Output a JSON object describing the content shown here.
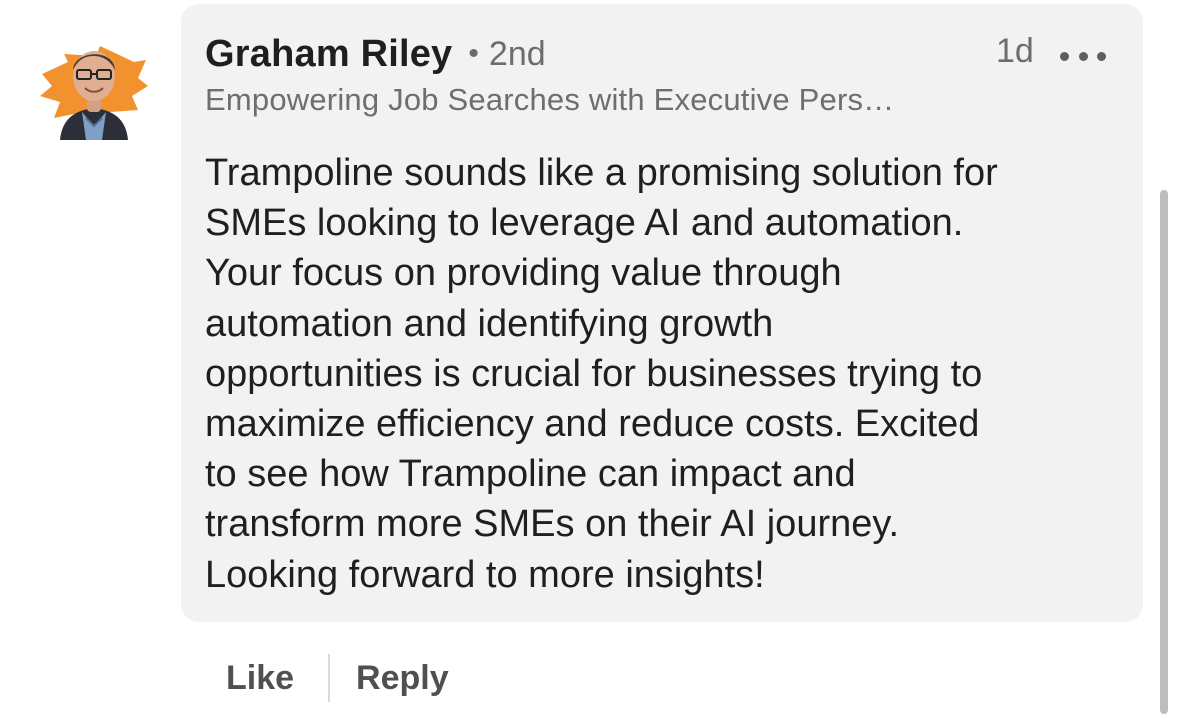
{
  "comment": {
    "author": {
      "name": "Graham Riley",
      "degree": "2nd",
      "headline": "Empowering Job Searches with Executive Pers…",
      "avatar_icon": "profile-photo",
      "avatar_accent": "#f2922f"
    },
    "separator": "•",
    "time": "1d",
    "more_icon": "more-options-icon",
    "text": "Trampoline sounds like a promising solution for\nSMEs looking to leverage AI and automation.\nYour focus on providing value through\nautomation and identifying growth\nopportunities is crucial for businesses trying to\nmaximize efficiency and reduce costs. Excited\nto see how Trampoline can impact and\ntransform more SMEs on their AI journey.\nLooking forward to more insights!",
    "bubble_color": "#f2f2f2"
  },
  "actions": {
    "like_label": "Like",
    "reply_label": "Reply"
  }
}
